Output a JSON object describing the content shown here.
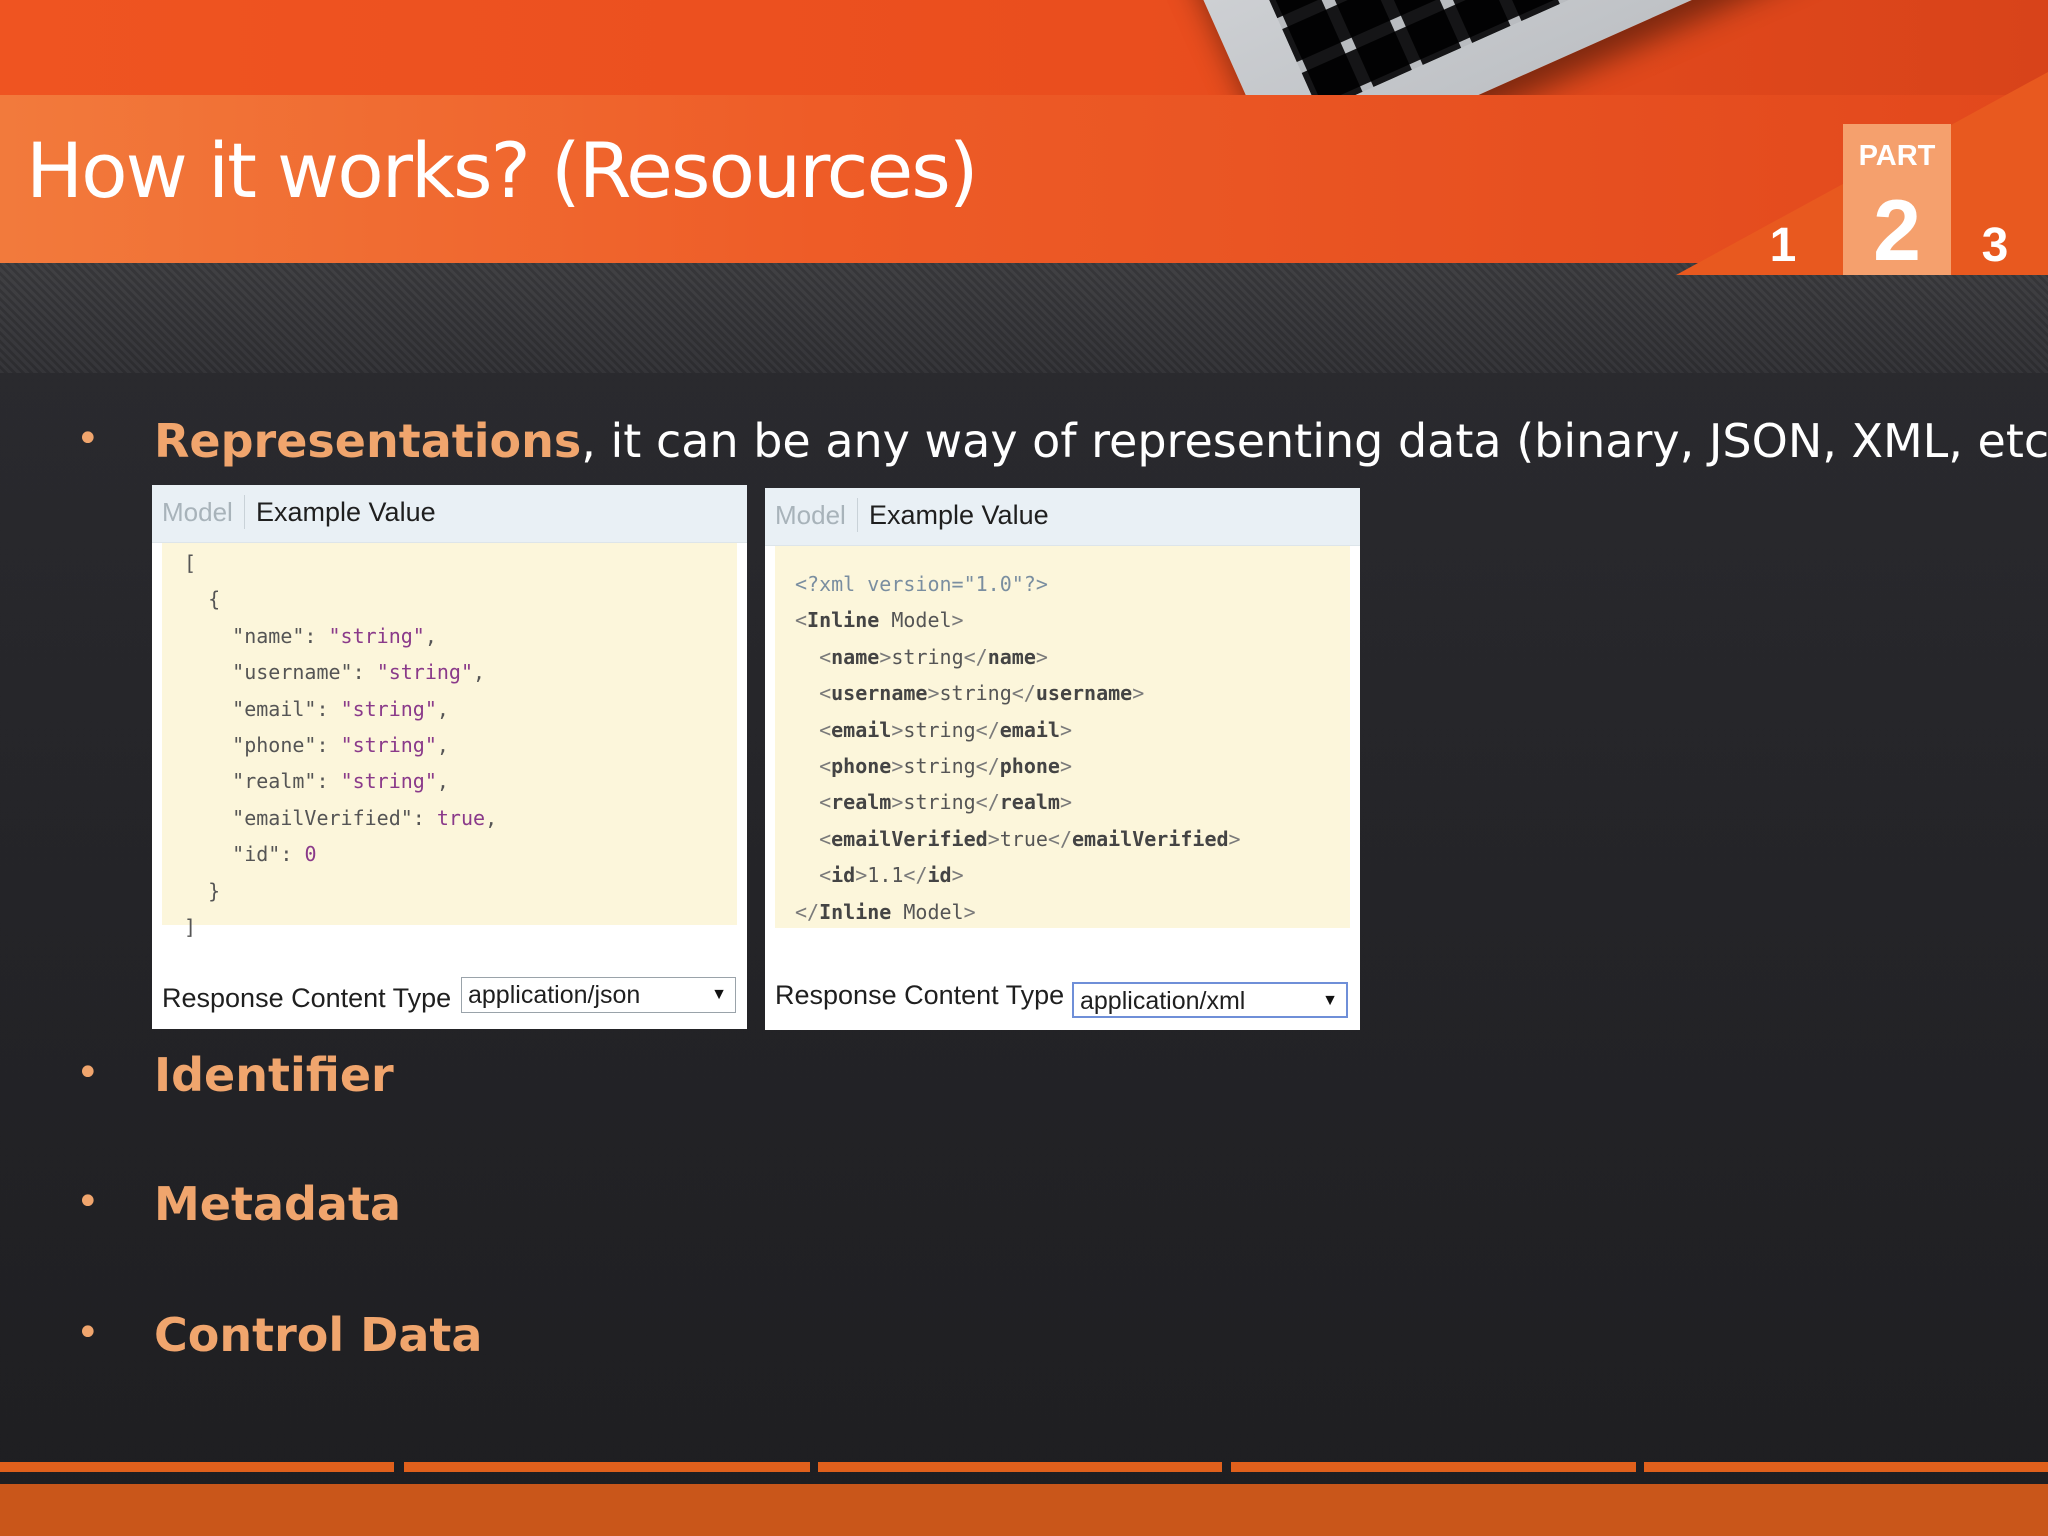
{
  "slide": {
    "title": "How it works? (Resources)"
  },
  "part_indicator": {
    "label": "PART",
    "numbers": [
      "1",
      "2",
      "3"
    ],
    "current": "2"
  },
  "bullets": [
    {
      "term": "Representations",
      "description": ", it can be any way of representing data (binary, JSON, XML, etc)"
    },
    {
      "term": "Identifier",
      "description": ""
    },
    {
      "term": "Metadata",
      "description": ""
    },
    {
      "term": "Control Data",
      "description": ""
    }
  ],
  "bullet_symbol": "•",
  "panels": {
    "json": {
      "tab_model": "Model",
      "tab_example": "Example Value",
      "response_label": "Response Content Type",
      "content_type": "application/json",
      "code_lines": [
        "[",
        "  {",
        "    \"name\": \"string\",",
        "    \"username\": \"string\",",
        "    \"email\": \"string\",",
        "    \"phone\": \"string\",",
        "    \"realm\": \"string\",",
        "    \"emailVerified\": true,",
        "    \"id\": 0",
        "  }",
        "]"
      ]
    },
    "xml": {
      "tab_model": "Model",
      "tab_example": "Example Value",
      "response_label": "Response Content Type",
      "content_type": "application/xml",
      "code_lines": [
        "<?xml version=\"1.0\"?>",
        "<Inline Model>",
        "  <name>string</name>",
        "  <username>string</username>",
        "  <email>string</email>",
        "  <phone>string</phone>",
        "  <realm>string</realm>",
        "  <emailVerified>true</emailVerified>",
        "  <id>1.1</id>",
        "</Inline Model>"
      ]
    }
  },
  "select_arrow": "▼",
  "colors": {
    "accent": "#f0a56d",
    "header_orange": "#ee5c27",
    "code_background": "#fcf6db",
    "bottom_bar": "#c9561a"
  }
}
